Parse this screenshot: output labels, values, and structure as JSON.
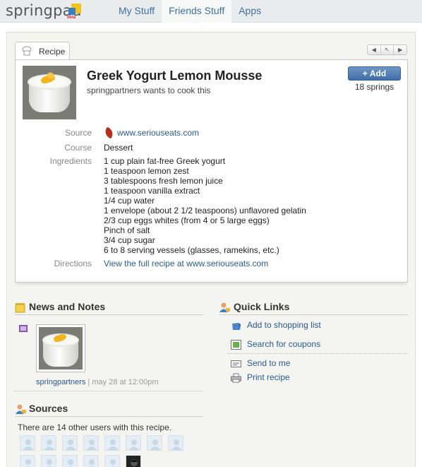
{
  "app": {
    "logo_text": "springpad",
    "logo_badge": "beta"
  },
  "nav": {
    "items": [
      {
        "label": "My Stuff"
      },
      {
        "label": "Friends Stuff"
      },
      {
        "label": "Apps"
      }
    ]
  },
  "tab": {
    "label": "Recipe",
    "icon": "chef-hat-icon"
  },
  "pager": {
    "prev": "◀",
    "up": "↖",
    "next": "▶"
  },
  "recipe": {
    "title": "Greek Yogurt Lemon Mousse",
    "subtitle": "springpartners wants to cook this",
    "add_label": "Add",
    "add_icon": "+",
    "springs": "18 springs",
    "source_label": "Source",
    "source_value": "www.seriouseats.com",
    "course_label": "Course",
    "course_value": "Dessert",
    "ingredients_label": "Ingredients",
    "ingredients": [
      "1 cup plain fat-free Greek yogurt",
      "1 teaspoon lemon zest",
      "3 tablespoons fresh lemon juice",
      "1 teaspoon vanilla extract",
      "1/4 cup water",
      "1 envelope (about 2 1/2 teaspoons) unflavored gelatin",
      "2/3 cup eggs whites (from 4 or 5 large eggs)",
      "Pinch of salt",
      "3/4 cup sugar",
      "6 to 8 serving vessels (glasses, ramekins, etc.)"
    ],
    "directions_label": "Directions",
    "directions_value": "View the full recipe at www.seriouseats.com"
  },
  "news": {
    "heading": "News and Notes",
    "author": "springpartners",
    "separator": "|",
    "date": "may 28 at 12:00pm"
  },
  "quick_links": {
    "heading": "Quick Links",
    "items": [
      {
        "label": "Add to shopping list",
        "icon": "shopping-bag-icon"
      },
      {
        "label": "Search for coupons",
        "icon": "coupon-icon"
      },
      {
        "label": "Send to me",
        "icon": "envelope-icon"
      },
      {
        "label": "Print recipe",
        "icon": "printer-icon"
      }
    ]
  },
  "sources": {
    "heading": "Sources",
    "text": "There are 14 other users with this recipe."
  },
  "colors": {
    "link": "#2a5a92",
    "nav_link": "#3f6fa0",
    "add_button": "#4a78ae",
    "accent_yellow": "#f3c318"
  }
}
